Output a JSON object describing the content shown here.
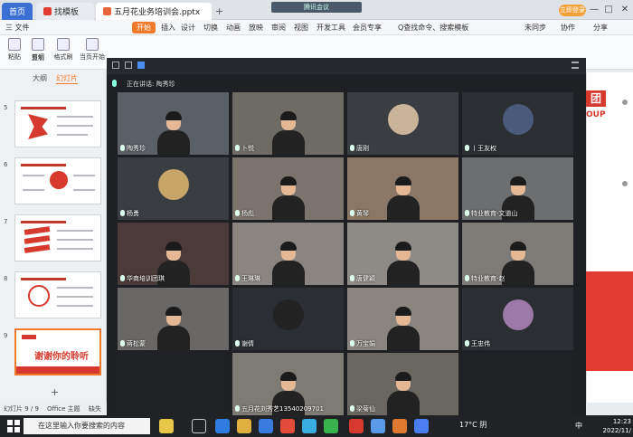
{
  "title_bar": {
    "tabs": [
      {
        "label": "首页"
      },
      {
        "label": "找模板"
      },
      {
        "label": "五月花业务培训会.pptx"
      }
    ],
    "plus": "+",
    "meeting_badge": "腾讯会议",
    "login_button": "立即登录",
    "window_controls": {
      "minimize": "—",
      "maximize": "□",
      "close": "✕"
    }
  },
  "menu_bar": {
    "file_menu": "三 文件",
    "items": [
      "开始",
      "插入",
      "设计",
      "切换",
      "动画",
      "放映",
      "审阅",
      "视图",
      "开发工具",
      "会员专享"
    ],
    "search_placeholder": "Q查找命令、搜索模板",
    "right_items": [
      "未同步",
      "协作",
      "分享"
    ]
  },
  "ribbon": {
    "buttons": [
      {
        "label": "粘贴"
      },
      {
        "label": "剪切"
      },
      {
        "label": "复制"
      },
      {
        "label": "格式刷"
      },
      {
        "label": "当页开始"
      }
    ]
  },
  "slide_pane": {
    "tabs": [
      "大纲",
      "幻灯片"
    ],
    "slide_numbers": [
      "5",
      "6",
      "7",
      "8",
      "9"
    ],
    "last_slide_title": "谢谢你的聆听",
    "add_slide": "+"
  },
  "status_bar": {
    "slide_counter": "幻灯片 9 / 9",
    "theme": "Office 主题",
    "extra": "缺失"
  },
  "slide_edge": {
    "logo_char": "团",
    "logo_text": "OUP"
  },
  "meeting": {
    "speaking_label": "正在讲话: 陶秀珍",
    "participants": [
      {
        "name": "陶秀珍",
        "style": "video"
      },
      {
        "name": "卜悦",
        "style": "video"
      },
      {
        "name": "唐刚",
        "style": "avatar"
      },
      {
        "name": "丨王友权",
        "style": "avatar"
      },
      {
        "name": "杨勇",
        "style": "avatar"
      },
      {
        "name": "杨彪",
        "style": "video"
      },
      {
        "name": "黄琴",
        "style": "video"
      },
      {
        "name": "特业教育-文道山",
        "style": "video"
      },
      {
        "name": "华商培训团琪",
        "style": "video"
      },
      {
        "name": "王琳琳",
        "style": "video"
      },
      {
        "name": "唐健颖",
        "style": "video"
      },
      {
        "name": "特业教育-赵",
        "style": "video"
      },
      {
        "name": "蒋松蒙",
        "style": "video"
      },
      {
        "name": "谢倩",
        "style": "avatar"
      },
      {
        "name": "万宝娟",
        "style": "video"
      },
      {
        "name": "王忠伟",
        "style": "avatar"
      },
      {
        "name": "",
        "style": "empty"
      },
      {
        "name": "五月花刘秀艺13540209701",
        "style": "video"
      },
      {
        "name": "梁菊仙",
        "style": "video"
      },
      {
        "name": "",
        "style": "empty"
      }
    ]
  },
  "taskbar": {
    "search_placeholder": "在这里输入你要搜索的内容",
    "weather": "17°C 阴",
    "ime": "中",
    "time": "12:23",
    "date": "2022/11/"
  }
}
